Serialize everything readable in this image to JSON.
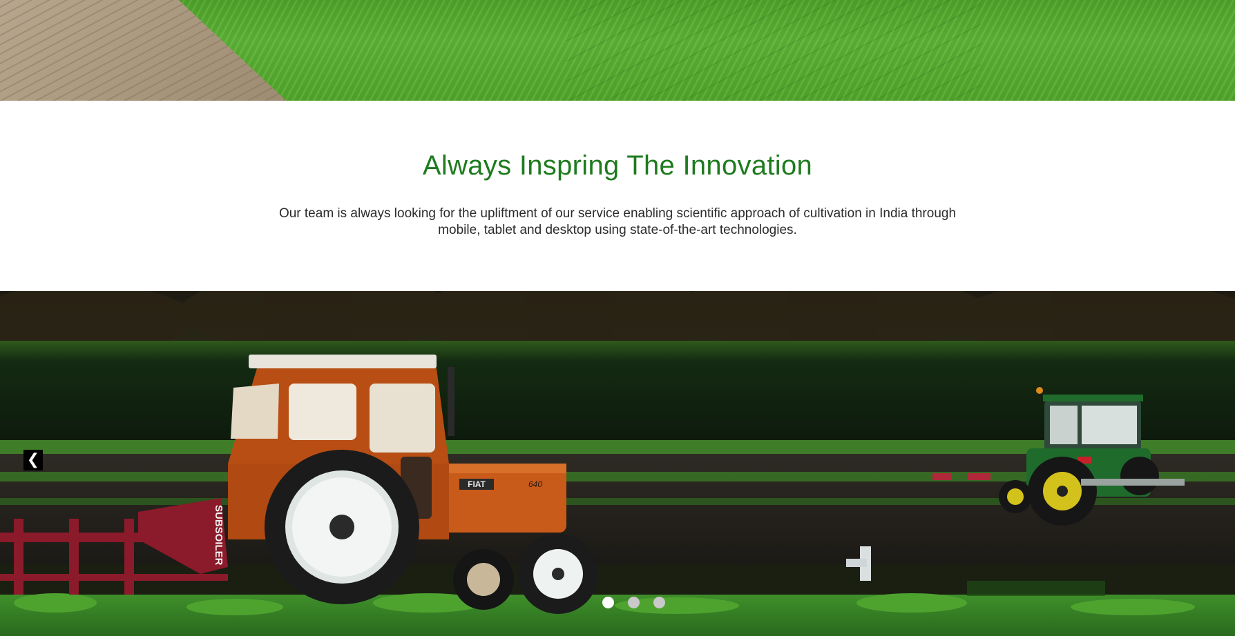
{
  "intro": {
    "title": "Always Inspring The Innovation",
    "description": "Our team is always looking for the upliftment of our service enabling scientific approach of cultivation in India through mobile, tablet and desktop using state-of-the-art technologies."
  },
  "carousel": {
    "prev_icon": "❮",
    "slide_count": 3,
    "active_slide": 1,
    "tractor_left": {
      "brand": "FIAT",
      "model": "640",
      "implement_label": "SUBSOILER"
    }
  },
  "colors": {
    "title_green": "#1e7b1e",
    "body_text": "#2b2b2b",
    "tractor_orange": "#c85a1a",
    "tractor_green": "#1f6b2c"
  }
}
